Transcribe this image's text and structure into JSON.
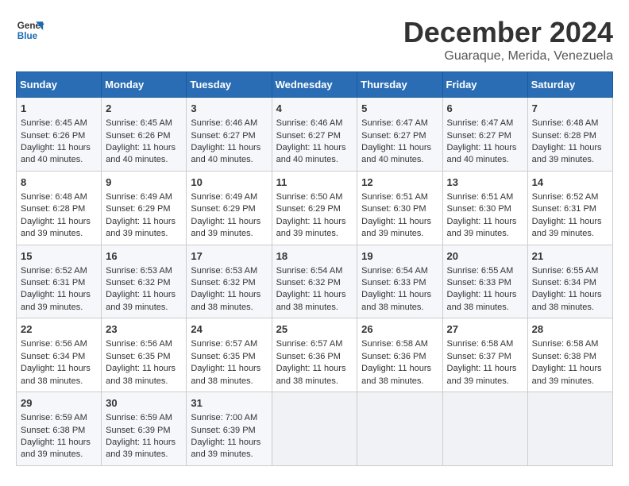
{
  "header": {
    "logo_line1": "General",
    "logo_line2": "Blue",
    "month": "December 2024",
    "location": "Guaraque, Merida, Venezuela"
  },
  "weekdays": [
    "Sunday",
    "Monday",
    "Tuesday",
    "Wednesday",
    "Thursday",
    "Friday",
    "Saturday"
  ],
  "weeks": [
    [
      {
        "day": "1",
        "sunrise": "6:45 AM",
        "sunset": "6:26 PM",
        "daylight": "Daylight: 11 hours and 40 minutes."
      },
      {
        "day": "2",
        "sunrise": "6:45 AM",
        "sunset": "6:26 PM",
        "daylight": "Daylight: 11 hours and 40 minutes."
      },
      {
        "day": "3",
        "sunrise": "6:46 AM",
        "sunset": "6:27 PM",
        "daylight": "Daylight: 11 hours and 40 minutes."
      },
      {
        "day": "4",
        "sunrise": "6:46 AM",
        "sunset": "6:27 PM",
        "daylight": "Daylight: 11 hours and 40 minutes."
      },
      {
        "day": "5",
        "sunrise": "6:47 AM",
        "sunset": "6:27 PM",
        "daylight": "Daylight: 11 hours and 40 minutes."
      },
      {
        "day": "6",
        "sunrise": "6:47 AM",
        "sunset": "6:27 PM",
        "daylight": "Daylight: 11 hours and 40 minutes."
      },
      {
        "day": "7",
        "sunrise": "6:48 AM",
        "sunset": "6:28 PM",
        "daylight": "Daylight: 11 hours and 39 minutes."
      }
    ],
    [
      {
        "day": "8",
        "sunrise": "6:48 AM",
        "sunset": "6:28 PM",
        "daylight": "Daylight: 11 hours and 39 minutes."
      },
      {
        "day": "9",
        "sunrise": "6:49 AM",
        "sunset": "6:29 PM",
        "daylight": "Daylight: 11 hours and 39 minutes."
      },
      {
        "day": "10",
        "sunrise": "6:49 AM",
        "sunset": "6:29 PM",
        "daylight": "Daylight: 11 hours and 39 minutes."
      },
      {
        "day": "11",
        "sunrise": "6:50 AM",
        "sunset": "6:29 PM",
        "daylight": "Daylight: 11 hours and 39 minutes."
      },
      {
        "day": "12",
        "sunrise": "6:51 AM",
        "sunset": "6:30 PM",
        "daylight": "Daylight: 11 hours and 39 minutes."
      },
      {
        "day": "13",
        "sunrise": "6:51 AM",
        "sunset": "6:30 PM",
        "daylight": "Daylight: 11 hours and 39 minutes."
      },
      {
        "day": "14",
        "sunrise": "6:52 AM",
        "sunset": "6:31 PM",
        "daylight": "Daylight: 11 hours and 39 minutes."
      }
    ],
    [
      {
        "day": "15",
        "sunrise": "6:52 AM",
        "sunset": "6:31 PM",
        "daylight": "Daylight: 11 hours and 39 minutes."
      },
      {
        "day": "16",
        "sunrise": "6:53 AM",
        "sunset": "6:32 PM",
        "daylight": "Daylight: 11 hours and 39 minutes."
      },
      {
        "day": "17",
        "sunrise": "6:53 AM",
        "sunset": "6:32 PM",
        "daylight": "Daylight: 11 hours and 38 minutes."
      },
      {
        "day": "18",
        "sunrise": "6:54 AM",
        "sunset": "6:32 PM",
        "daylight": "Daylight: 11 hours and 38 minutes."
      },
      {
        "day": "19",
        "sunrise": "6:54 AM",
        "sunset": "6:33 PM",
        "daylight": "Daylight: 11 hours and 38 minutes."
      },
      {
        "day": "20",
        "sunrise": "6:55 AM",
        "sunset": "6:33 PM",
        "daylight": "Daylight: 11 hours and 38 minutes."
      },
      {
        "day": "21",
        "sunrise": "6:55 AM",
        "sunset": "6:34 PM",
        "daylight": "Daylight: 11 hours and 38 minutes."
      }
    ],
    [
      {
        "day": "22",
        "sunrise": "6:56 AM",
        "sunset": "6:34 PM",
        "daylight": "Daylight: 11 hours and 38 minutes."
      },
      {
        "day": "23",
        "sunrise": "6:56 AM",
        "sunset": "6:35 PM",
        "daylight": "Daylight: 11 hours and 38 minutes."
      },
      {
        "day": "24",
        "sunrise": "6:57 AM",
        "sunset": "6:35 PM",
        "daylight": "Daylight: 11 hours and 38 minutes."
      },
      {
        "day": "25",
        "sunrise": "6:57 AM",
        "sunset": "6:36 PM",
        "daylight": "Daylight: 11 hours and 38 minutes."
      },
      {
        "day": "26",
        "sunrise": "6:58 AM",
        "sunset": "6:36 PM",
        "daylight": "Daylight: 11 hours and 38 minutes."
      },
      {
        "day": "27",
        "sunrise": "6:58 AM",
        "sunset": "6:37 PM",
        "daylight": "Daylight: 11 hours and 39 minutes."
      },
      {
        "day": "28",
        "sunrise": "6:58 AM",
        "sunset": "6:38 PM",
        "daylight": "Daylight: 11 hours and 39 minutes."
      }
    ],
    [
      {
        "day": "29",
        "sunrise": "6:59 AM",
        "sunset": "6:38 PM",
        "daylight": "Daylight: 11 hours and 39 minutes."
      },
      {
        "day": "30",
        "sunrise": "6:59 AM",
        "sunset": "6:39 PM",
        "daylight": "Daylight: 11 hours and 39 minutes."
      },
      {
        "day": "31",
        "sunrise": "7:00 AM",
        "sunset": "6:39 PM",
        "daylight": "Daylight: 11 hours and 39 minutes."
      },
      null,
      null,
      null,
      null
    ]
  ]
}
